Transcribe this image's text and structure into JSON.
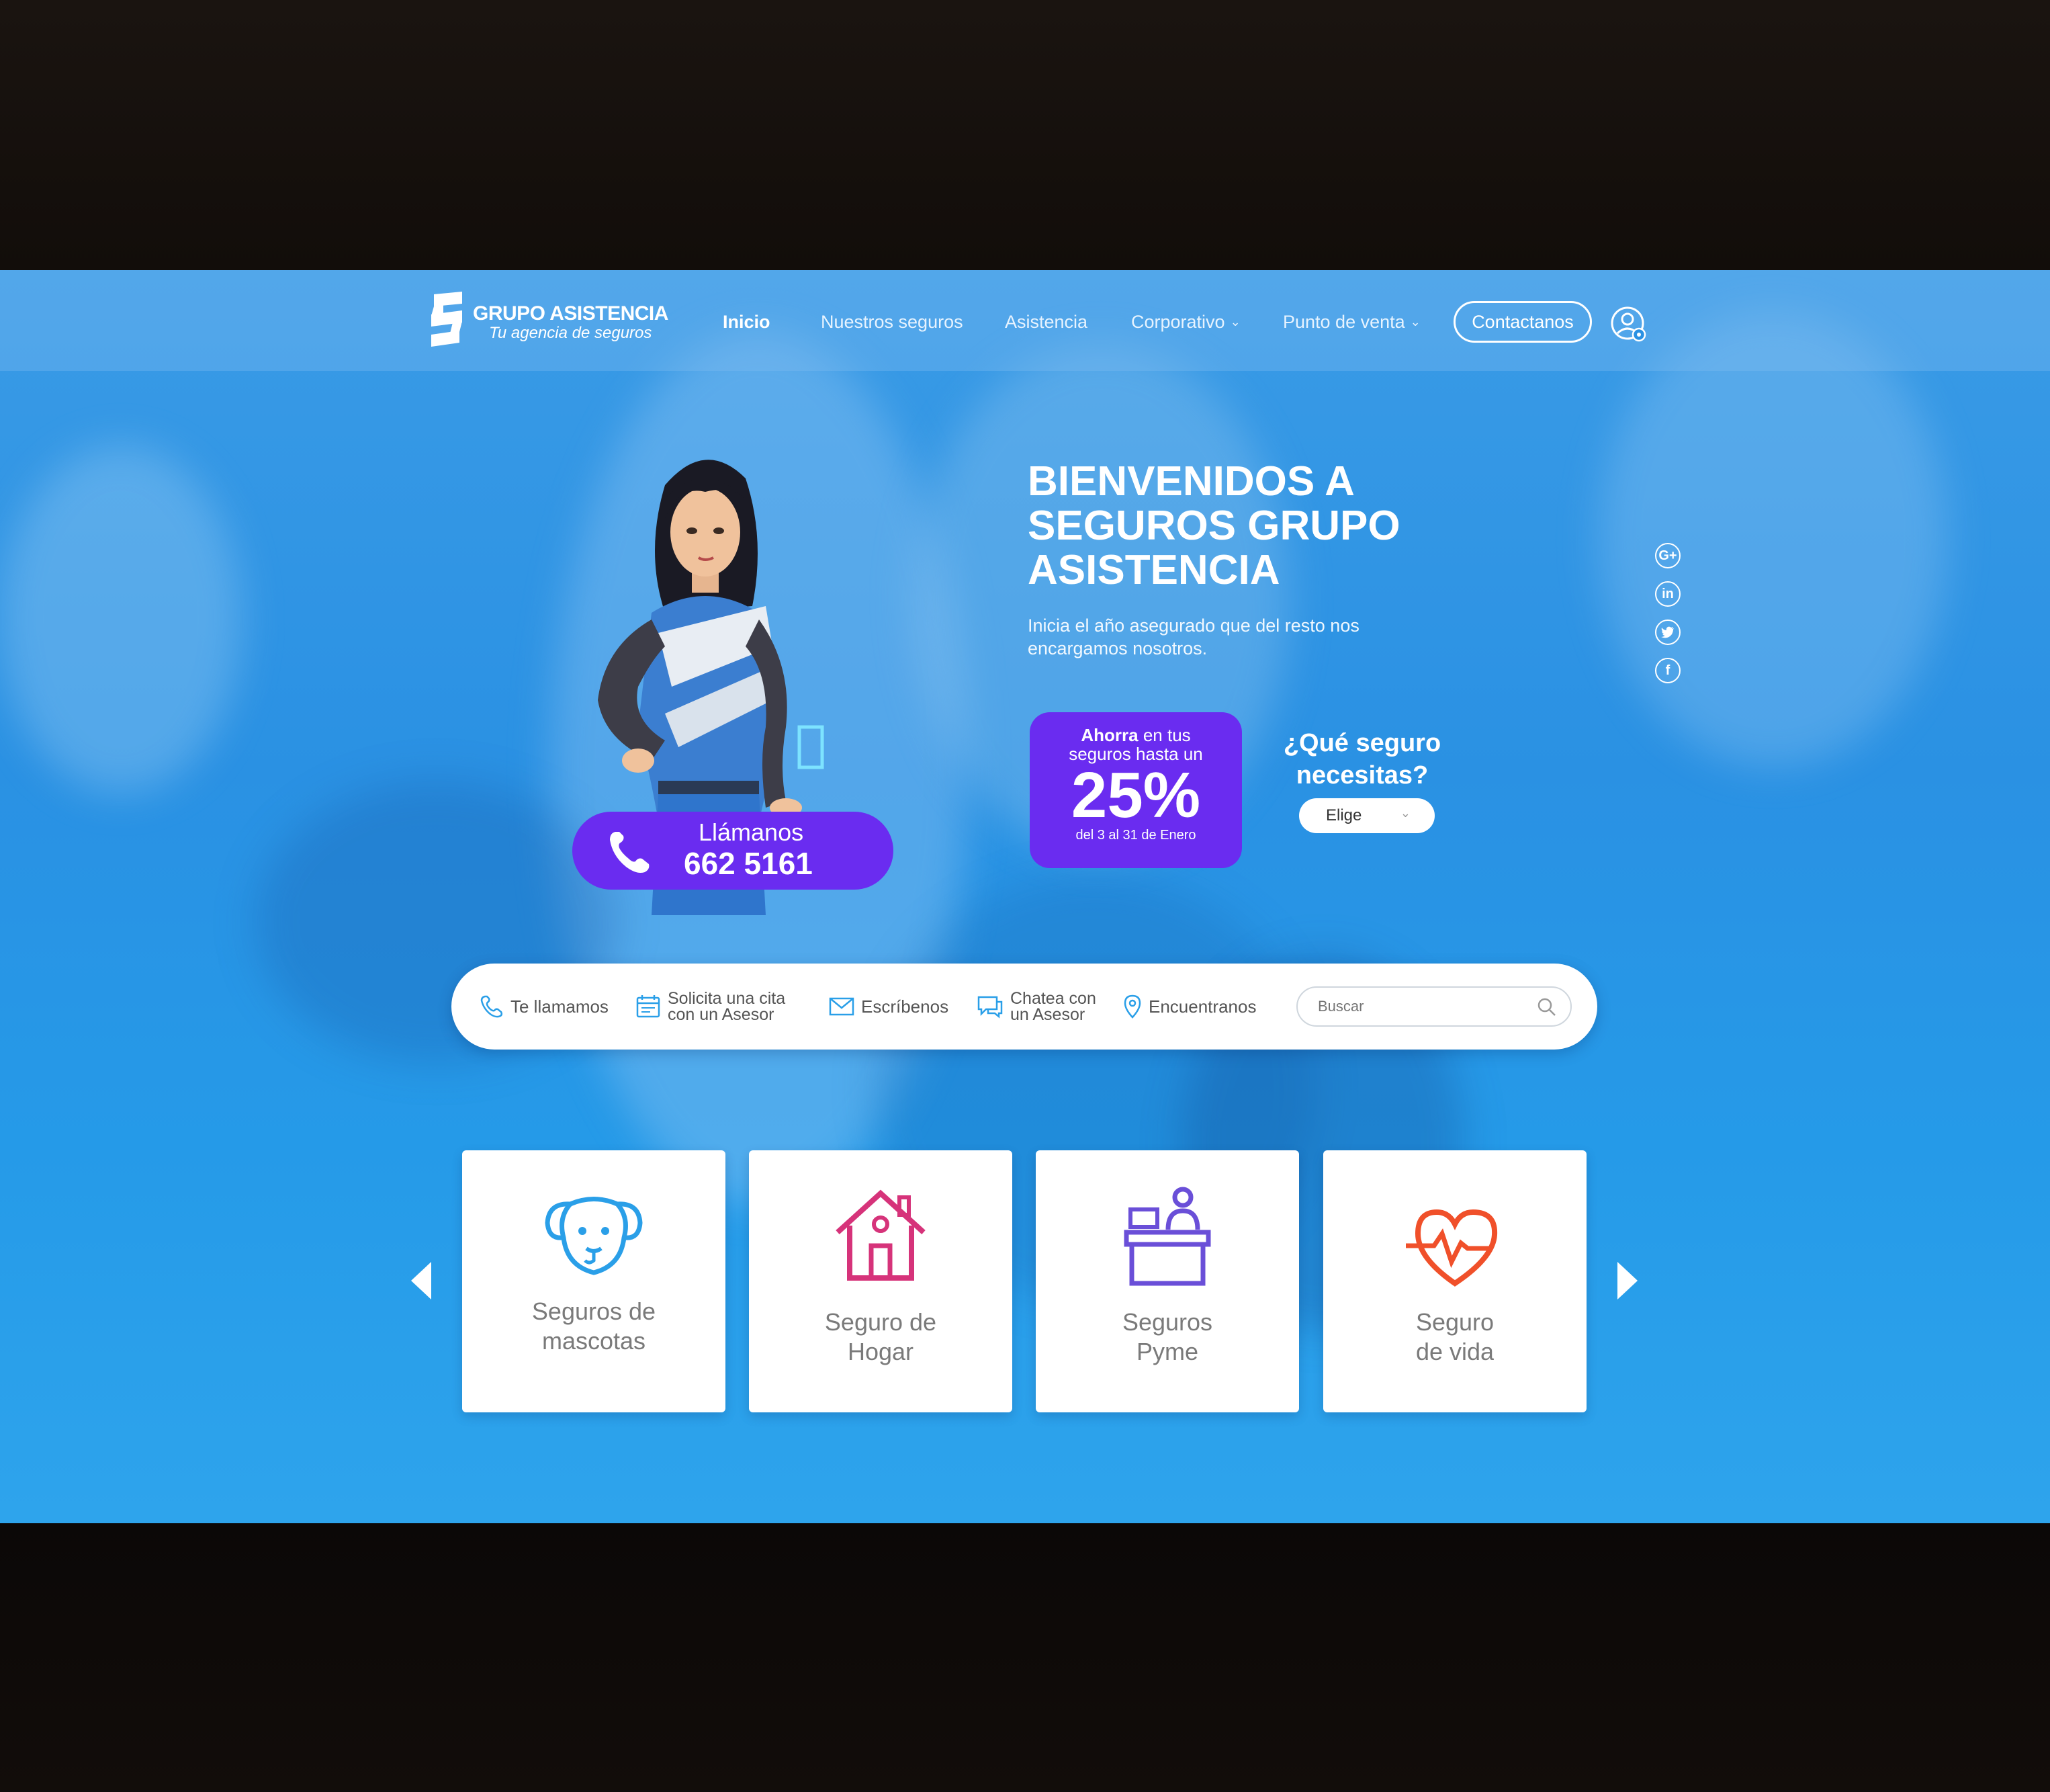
{
  "brand": {
    "name": "GRUPO ASISTENCIA",
    "tagline": "Tu agencia de seguros"
  },
  "nav": {
    "items": [
      {
        "label": "Inicio"
      },
      {
        "label": "Nuestros seguros"
      },
      {
        "label": "Asistencia"
      },
      {
        "label": "Corporativo"
      },
      {
        "label": "Punto de venta"
      }
    ],
    "contact_label": "Contactanos"
  },
  "hero": {
    "title": "BIENVENIDOS A SEGUROS GRUPO ASISTENCIA",
    "subtitle": "Inicia el año asegurado que del resto nos encargamos nosotros.",
    "call_label": "Llámanos",
    "call_number": "662 5161",
    "promo": {
      "bold": "Ahorra",
      "text_1": "en tus",
      "text_2": "seguros hasta un",
      "percent": "25%",
      "date": "del 3 al 31 de Enero"
    },
    "question": "¿Qué seguro necesitas?",
    "select_value": "Elige"
  },
  "social": [
    "G+",
    "in",
    "twitter",
    "f"
  ],
  "actions": {
    "call": "Te llamamos",
    "appointment_1": "Solicita una cita",
    "appointment_2": "con un Asesor",
    "write": "Escríbenos",
    "chat_1": "Chatea con",
    "chat_2": "un Asesor",
    "locate": "Encuentranos",
    "search_placeholder": "Buscar"
  },
  "cards": [
    {
      "line1": "Seguros de",
      "line2": "mascotas",
      "icon": "dog-icon",
      "color": "#2a9fe8"
    },
    {
      "line1": "Seguro de",
      "line2": "Hogar",
      "icon": "house-icon",
      "color": "#d6337a"
    },
    {
      "line1": "Seguros",
      "line2": "Pyme",
      "icon": "desk-icon",
      "color": "#6a4fd8"
    },
    {
      "line1": "Seguro",
      "line2": "de vida",
      "icon": "heart-pulse-icon",
      "color": "#f0502a"
    }
  ],
  "colors": {
    "primary_blue": "#2a91e3",
    "accent_purple": "#6a2cf0"
  }
}
